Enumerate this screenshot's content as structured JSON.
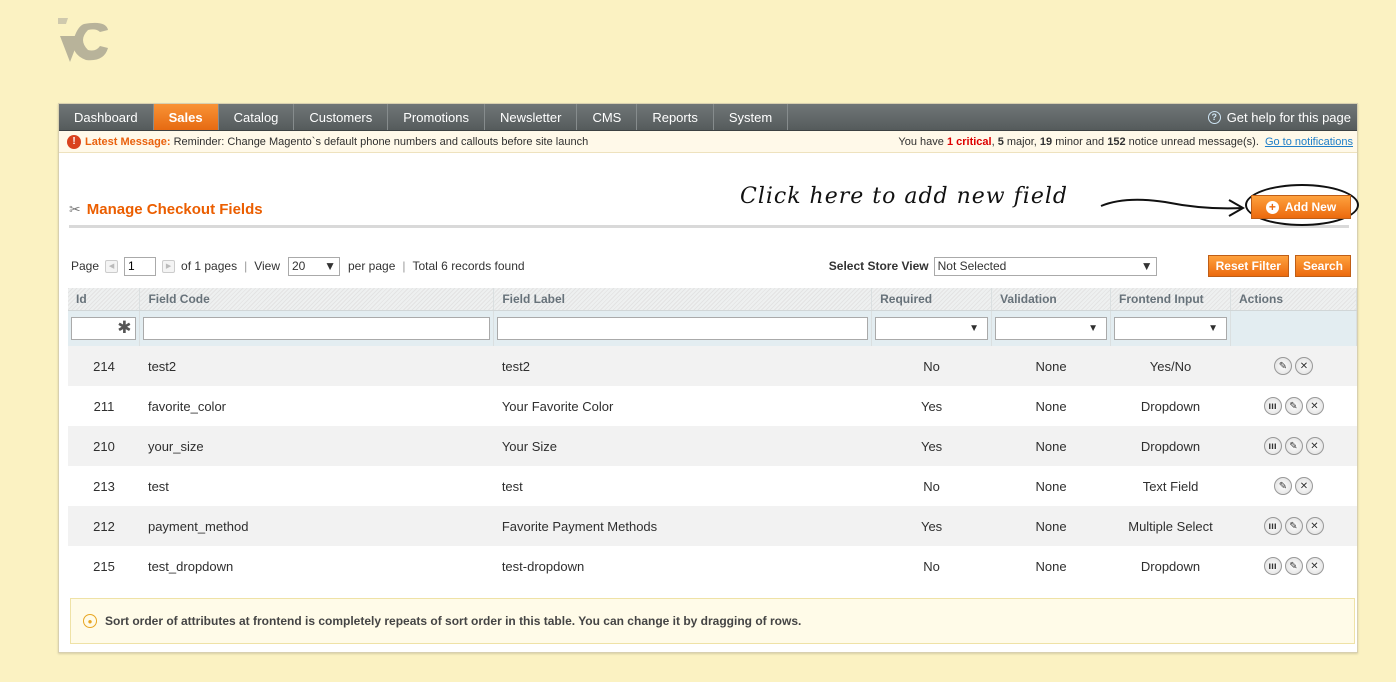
{
  "nav": {
    "items": [
      "Dashboard",
      "Sales",
      "Catalog",
      "Customers",
      "Promotions",
      "Newsletter",
      "CMS",
      "Reports",
      "System"
    ],
    "active": "Sales",
    "help": "Get help for this page"
  },
  "message": {
    "title": "Latest Message:",
    "text": "Reminder: Change Magento`s default phone numbers and callouts before site launch",
    "prefix": "You have",
    "critical": "1 critical",
    "major_count": "5",
    "major_rest": "major,",
    "minor_count": "19",
    "minor_rest": "minor and",
    "notice_count": "152",
    "notice_rest": "notice unread message(s).",
    "link": "Go to notifications"
  },
  "header": {
    "title": "Manage Checkout Fields",
    "annotation": "Click here to add new field",
    "add_new": "Add New"
  },
  "pager": {
    "page_label": "Page",
    "page_value": "1",
    "of_pages": "of 1 pages",
    "view_label": "View",
    "view_value": "20",
    "per_page": "per page",
    "total": "Total 6 records found",
    "store_label": "Select Store View",
    "store_value": "Not Selected",
    "reset_filter": "Reset Filter",
    "search": "Search"
  },
  "table": {
    "columns": [
      "Id",
      "Field Code",
      "Field Label",
      "Required",
      "Validation",
      "Frontend Input",
      "Actions"
    ],
    "rows": [
      {
        "id": "214",
        "code": "test2",
        "label": "test2",
        "required": "No",
        "validation": "None",
        "input": "Yes/No",
        "actions": 2
      },
      {
        "id": "211",
        "code": "favorite_color",
        "label": "Your Favorite Color",
        "required": "Yes",
        "validation": "None",
        "input": "Dropdown",
        "actions": 3
      },
      {
        "id": "210",
        "code": "your_size",
        "label": "Your Size",
        "required": "Yes",
        "validation": "None",
        "input": "Dropdown",
        "actions": 3
      },
      {
        "id": "213",
        "code": "test",
        "label": "test",
        "required": "No",
        "validation": "None",
        "input": "Text Field",
        "actions": 2
      },
      {
        "id": "212",
        "code": "payment_method",
        "label": "Favorite Payment Methods",
        "required": "Yes",
        "validation": "None",
        "input": "Multiple Select",
        "actions": 3
      },
      {
        "id": "215",
        "code": "test_dropdown",
        "label": "test-dropdown",
        "required": "No",
        "validation": "None",
        "input": "Dropdown",
        "actions": 3
      }
    ]
  },
  "note": "Sort order of attributes at frontend is completely repeats of sort order in this table. You can change it by dragging of rows.",
  "icons": {
    "help": "help-icon",
    "warning": "warning-icon",
    "title": "tools-icon",
    "add": "plus-circle-icon",
    "stats": "stats-icon",
    "edit": "edit-icon",
    "delete": "delete-icon",
    "bulb": "lightbulb-icon"
  },
  "colors": {
    "background": "#fbf2c2",
    "accent": "#eb5e00",
    "nav": "#606667"
  }
}
